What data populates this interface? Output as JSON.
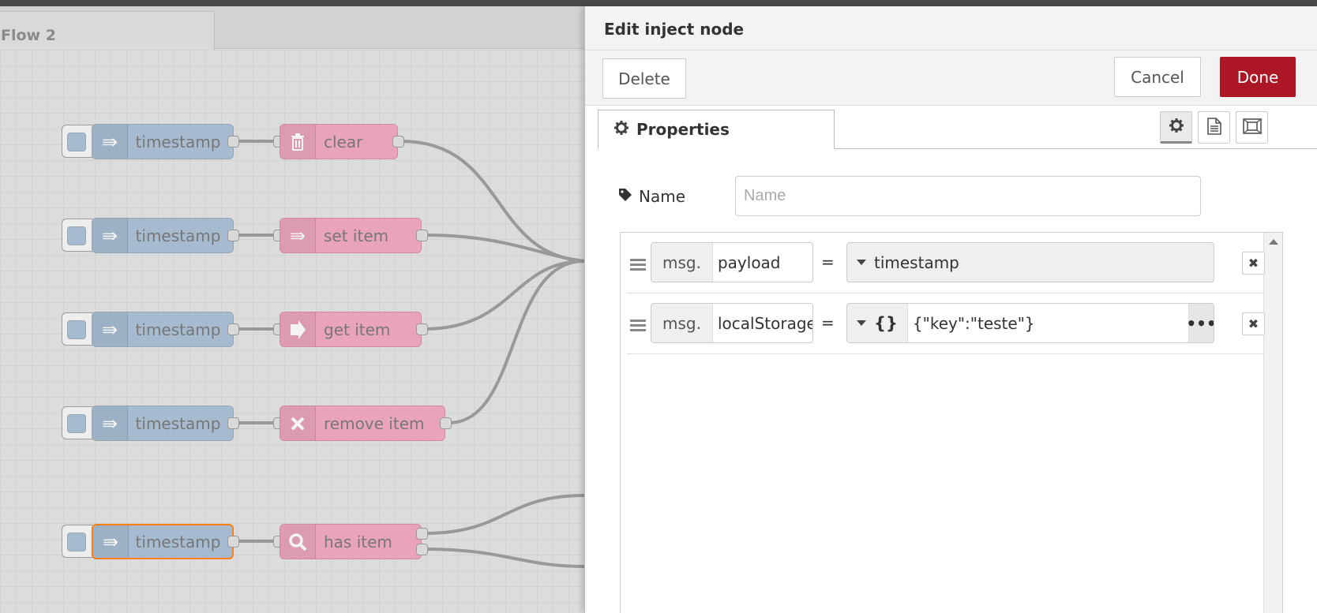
{
  "workspace": {
    "flow_tab_label": "Flow 2",
    "rows": [
      {
        "inject_label": "timestamp",
        "node_label": "clear",
        "node_icon": "trash-icon"
      },
      {
        "inject_label": "timestamp",
        "node_label": "set item",
        "node_icon": "arrow-in-icon"
      },
      {
        "inject_label": "timestamp",
        "node_label": "get item",
        "node_icon": "arrow-right-icon"
      },
      {
        "inject_label": "timestamp",
        "node_label": "remove item",
        "node_icon": "close-x-icon"
      },
      {
        "inject_label": "timestamp",
        "node_label": "has item",
        "node_icon": "search-icon"
      }
    ]
  },
  "tray": {
    "title": "Edit inject node",
    "delete_label": "Delete",
    "cancel_label": "Cancel",
    "done_label": "Done",
    "properties_tab_label": "Properties",
    "name_label": "Name",
    "name_placeholder": "Name",
    "props": [
      {
        "prefix": "msg.",
        "property": "payload",
        "value_type_icon": "",
        "value": "timestamp"
      },
      {
        "prefix": "msg.",
        "property": "localStorage",
        "value_type_icon": "{}",
        "value": "{\"key\":\"teste\"}"
      }
    ],
    "equals": "=",
    "more_label": "•••",
    "remove_label": "✖"
  },
  "colors": {
    "inject_node": "#a6bbcf",
    "storage_node": "#e9a4bb",
    "done_button": "#ad1625",
    "selected_outline": "#ff7f0e"
  }
}
